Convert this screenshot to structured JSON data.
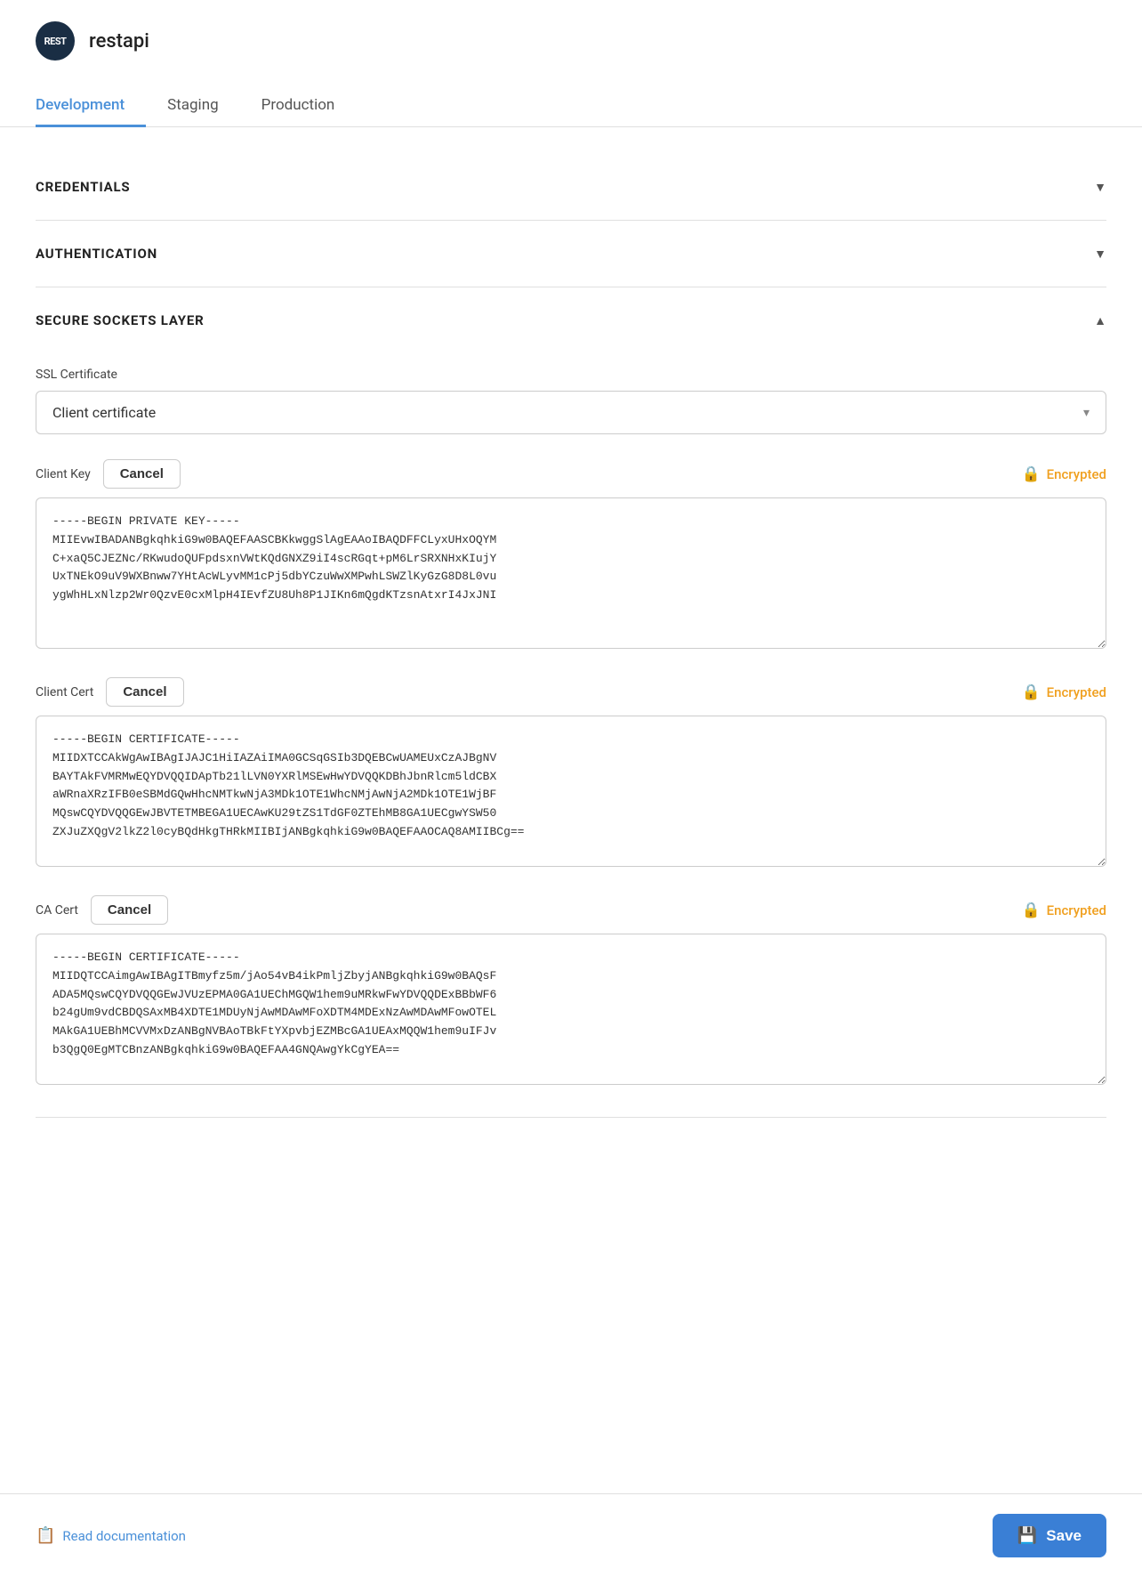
{
  "app": {
    "logo_text": "REST",
    "name": "restapi"
  },
  "tabs": [
    {
      "id": "development",
      "label": "Development",
      "active": true
    },
    {
      "id": "staging",
      "label": "Staging",
      "active": false
    },
    {
      "id": "production",
      "label": "Production",
      "active": false
    }
  ],
  "sections": [
    {
      "id": "credentials",
      "title": "CREDENTIALS",
      "expanded": false,
      "chevron": "▼"
    },
    {
      "id": "authentication",
      "title": "AUTHENTICATION",
      "expanded": false,
      "chevron": "▼"
    },
    {
      "id": "ssl",
      "title": "SECURE SOCKETS LAYER",
      "expanded": true,
      "chevron": "▲"
    }
  ],
  "ssl": {
    "certificate_label": "SSL Certificate",
    "certificate_value": "Client certificate",
    "certificate_placeholder": "Client certificate",
    "fields": [
      {
        "id": "client-key",
        "label": "Client Key",
        "cancel_label": "Cancel",
        "encrypted_label": "Encrypted",
        "content": "-----BEGIN PRIVATE KEY-----\nMIIEvwIBADANBgkqhkiG9w0BAQEFAASCBKkwggSlAgEAAoIBAQDFFCLyxUHxOQYM\nC+xaQ5CJEZNc/RKwudoQUFpdsxnVWtKQdGNXZ9iI4scRGqt+pM6LrSRXNHxKIujY\nUxTNEkO9uV9WXBnww7YHtAcWLyvMM1cPj5dbYCzuWwXMPwhLSWZlKyGzG8D8L0vu\nygWhHLxNlzp2Wr0QzvE0cxMlpH4IEvfZU8Uh8P1JIKn6mQgdKTzsnAtxrI4JxJNI"
      },
      {
        "id": "client-cert",
        "label": "Client Cert",
        "cancel_label": "Cancel",
        "encrypted_label": "Encrypted",
        "content": "-----BEGIN CERTIFICATE-----\nMIIDXTCCAkWgAwIBAgIJAJC1HiIAZAiIMA0GCSqGSIb3DQEBCwUAMEUxCzAJBgNV\nBAYTAkFVMRMwEQYDVQQIDApTb21lLVN0YXRlMSEwHwYDVQQKDBhJbnRlcm5ldCBX\naWRnaXRzIFB0eSBMdGQwHhcNMTkwNjA3MDk1OTE1WhcNMjAwNjA2MDk1OTE1WjBF\nMQswCQYDVQQGEwJBVTETMBEGA1UECAwKU29tZS1TdGF0ZTEhMB8GA1UECgwYSW50\nZXJuZXQgV2lkZ2l0cyBQdHkgTHRkMIIBIjANBgkqhkiG9w0BAQEFAAOCAQ8AMIIBCg=="
      },
      {
        "id": "ca-cert",
        "label": "CA Cert",
        "cancel_label": "Cancel",
        "encrypted_label": "Encrypted",
        "content": "-----BEGIN CERTIFICATE-----\nMIIDQTCCAimgAwIBAgITBmyfz5m/jAo54vB4ikPmljZbyjANBgkqhkiG9w0BAQsF\nADA5MQswCQYDVQQGEwJVUzEPMA0GA1UEChMGQW1hem9uMRkwFwYDVQQDExBBbWF6\nb24gUm9vdCBDQSAxMB4XDTE1MDUyNjAwMDAwMFoXDTM4MDExNzAwMDAwMFowOTEL\nMAkGA1UEBhMCVVMxDzANBgNVBAoTBkFtYXpvbjEZMBcGA1UEAxMQQW1hem9uIFJv\nb3QgQ0EgMTCBnzANBgkqhkiG9w0BAQEFAA4GNQAwgYkCgYEA=="
      }
    ]
  },
  "footer": {
    "read_docs_label": "Read documentation",
    "save_label": "Save"
  }
}
